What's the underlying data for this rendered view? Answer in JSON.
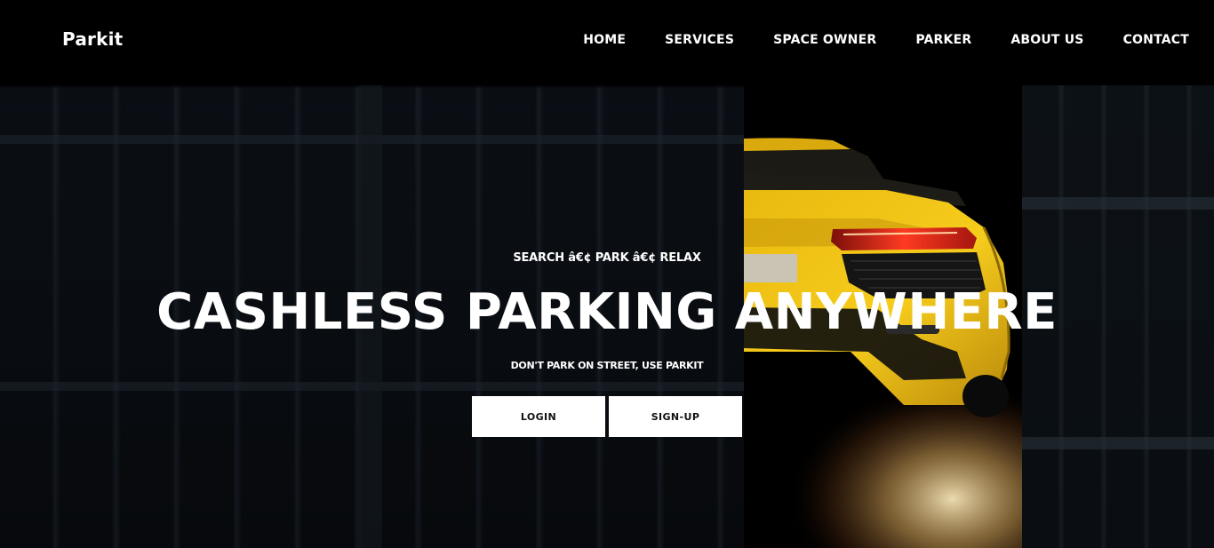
{
  "brand": "Parkit",
  "nav": [
    "HOME",
    "SERVICES",
    "SPACE OWNER",
    "PARKER",
    "ABOUT US",
    "CONTACT"
  ],
  "hero": {
    "tagline": "SEARCH â€¢ PARK â€¢ RELAX",
    "headline": "CASHLESS PARKING ANYWHERE",
    "subline": "DON'T PARK ON STREET, USE PARKIT",
    "login_label": "LOGIN",
    "signup_label": "SIGN-UP"
  },
  "colors": {
    "header_bg": "#000000",
    "button_bg": "#ffffff",
    "car_yellow": "#f2c316",
    "taillight_red": "#d8261a"
  },
  "icons": {
    "hero_image": "yellow-sports-car-rear-photo"
  }
}
